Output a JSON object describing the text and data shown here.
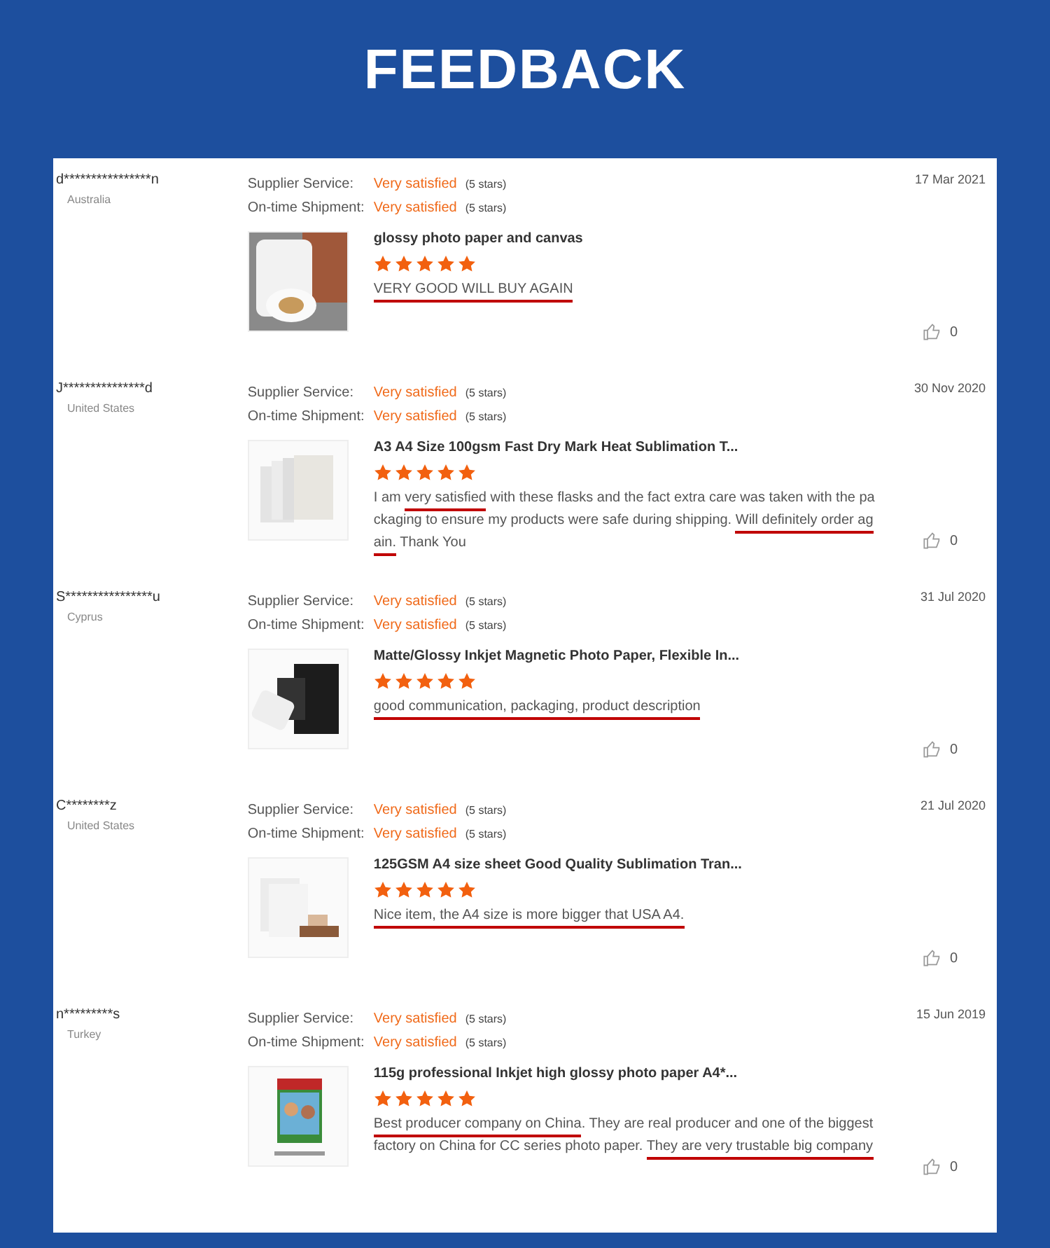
{
  "title": "FEEDBACK",
  "reviews": [
    {
      "buyer": "d****************n",
      "country": "Australia",
      "date": "17 Mar 2021",
      "ratings": [
        {
          "label": "Supplier Service:",
          "value": "Very satisfied",
          "stars_text": "(5 stars)"
        },
        {
          "label": "On-time Shipment:",
          "value": "Very satisfied",
          "stars_text": "(5 stars)"
        }
      ],
      "product": "glossy photo paper and canvas",
      "stars": 5,
      "comment": [
        {
          "text": "VERY GOOD WILL BUY AGAIN",
          "underlined": true
        }
      ],
      "likes": "0"
    },
    {
      "buyer": "J***************d",
      "country": "United States",
      "date": "30 Nov 2020",
      "ratings": [
        {
          "label": "Supplier Service:",
          "value": "Very satisfied",
          "stars_text": "(5 stars)"
        },
        {
          "label": "On-time Shipment:",
          "value": "Very satisfied",
          "stars_text": "(5 stars)"
        }
      ],
      "product": "A3 A4 Size 100gsm Fast Dry Mark Heat Sublimation T...",
      "stars": 5,
      "comment": [
        {
          "text": "I am ",
          "underlined": false
        },
        {
          "text": "very satisfied",
          "underlined": true
        },
        {
          "text": " with these flasks and the fact extra care was taken with the packaging to ensure my products were safe during shipping. ",
          "underlined": false
        },
        {
          "text": "Will definitely order again.",
          "underlined": true
        },
        {
          "text": " Thank You",
          "underlined": false
        }
      ],
      "likes": "0"
    },
    {
      "buyer": "S****************u",
      "country": "Cyprus",
      "date": "31 Jul 2020",
      "ratings": [
        {
          "label": "Supplier Service:",
          "value": "Very satisfied",
          "stars_text": "(5 stars)"
        },
        {
          "label": "On-time Shipment:",
          "value": "Very satisfied",
          "stars_text": "(5 stars)"
        }
      ],
      "product": "Matte/Glossy Inkjet Magnetic Photo Paper, Flexible In...",
      "stars": 5,
      "comment": [
        {
          "text": "good communication, packaging, product description",
          "underlined": true
        }
      ],
      "likes": "0"
    },
    {
      "buyer": "C********z",
      "country": "United States",
      "date": "21 Jul 2020",
      "ratings": [
        {
          "label": "Supplier Service:",
          "value": "Very satisfied",
          "stars_text": "(5 stars)"
        },
        {
          "label": "On-time Shipment:",
          "value": "Very satisfied",
          "stars_text": "(5 stars)"
        }
      ],
      "product": "125GSM A4 size sheet Good Quality Sublimation Tran...",
      "stars": 5,
      "comment": [
        {
          "text": "Nice item, the A4 size is more bigger that USA A4.",
          "underlined": true
        }
      ],
      "likes": "0"
    },
    {
      "buyer": "n*********s",
      "country": "Turkey",
      "date": "15 Jun 2019",
      "ratings": [
        {
          "label": "Supplier Service:",
          "value": "Very satisfied",
          "stars_text": "(5 stars)"
        },
        {
          "label": "On-time Shipment:",
          "value": "Very satisfied",
          "stars_text": "(5 stars)"
        }
      ],
      "product": "115g professional Inkjet high glossy photo paper A4*...",
      "stars": 5,
      "comment": [
        {
          "text": "Best producer company on China",
          "underlined": true
        },
        {
          "text": ". They are real producer and one of the biggest factory on China for CC series photo paper. ",
          "underlined": false
        },
        {
          "text": "They are very trustable big company",
          "underlined": true
        }
      ],
      "likes": "0"
    }
  ]
}
